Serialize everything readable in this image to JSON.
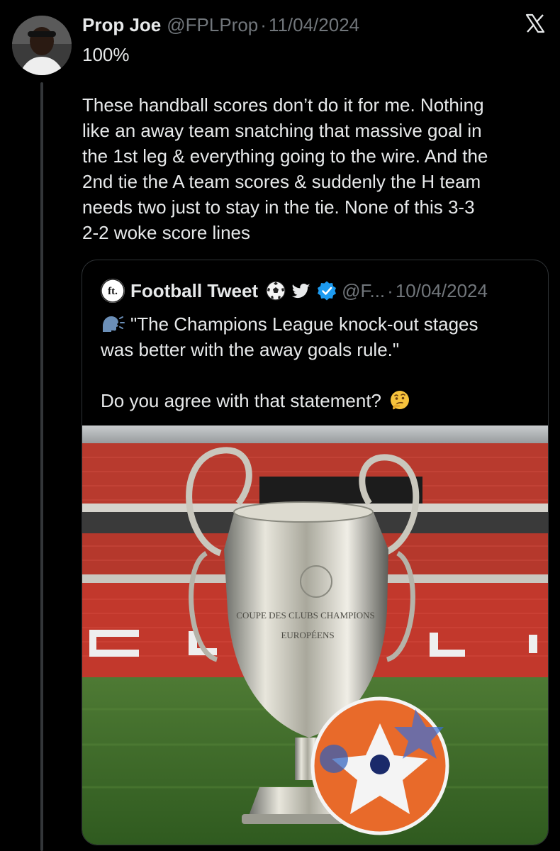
{
  "tweet": {
    "display_name": "Prop Joe",
    "handle": "@FPLProp",
    "separator": "·",
    "date": "11/04/2024",
    "lead": "100%",
    "body_lines": [
      "These handball scores don’t do it for me. Nothing",
      "like an away team snatching that massive goal in",
      "the 1st leg & everything going to the wire. And the",
      "2nd tie the A team scores & suddenly the H team",
      "needs two just to stay in the tie. None of this 3-3",
      "2-2 woke score lines"
    ],
    "avatar_icon": "profile-photo"
  },
  "app": {
    "close_icon": "x-logo-icon"
  },
  "quote": {
    "avatar_text": "ft.",
    "display_name": "Football Tweet",
    "handle": "@F...",
    "separator": "·",
    "date": "10/04/2024",
    "text_line1": "\"The Champions League knock-out stages",
    "text_line2": "was better with the away goals rule.\"",
    "text_line3": "Do you agree with that statement?",
    "media_caption_lines": [
      "COUPE DES CLUBS CHAMPIONS",
      "EUROPÉENS"
    ],
    "icons": [
      "soccer-ball-icon",
      "twitter-bird-icon",
      "verified-badge-icon",
      "speaking-head-icon",
      "thinking-face-icon"
    ]
  },
  "colors": {
    "background": "#000000",
    "text_primary": "#e7e9ea",
    "text_secondary": "#71767b",
    "border": "#2f3336",
    "verified": "#1d9bf0"
  }
}
